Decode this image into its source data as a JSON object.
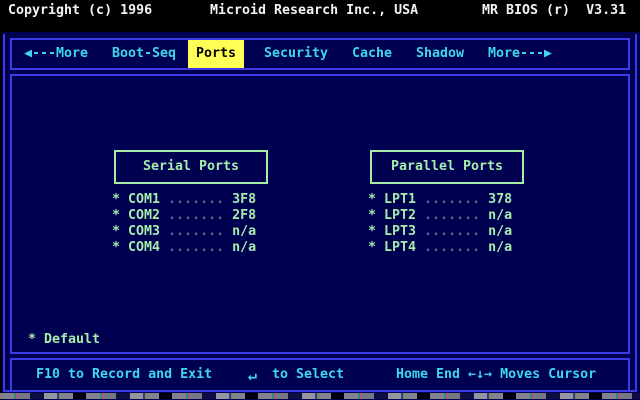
{
  "topbar": {
    "copyright": "Copyright (c) 1996",
    "company": "Microid Research Inc., USA",
    "product": "MR BIOS (r)  V3.31"
  },
  "menu": {
    "items": [
      {
        "label": "◀---More"
      },
      {
        "label": "Boot-Seq"
      },
      {
        "label": "Ports",
        "active": true
      },
      {
        "label": "Security"
      },
      {
        "label": "Cache"
      },
      {
        "label": "Shadow"
      },
      {
        "label": "More---▶"
      }
    ]
  },
  "sections": {
    "serial": {
      "title": "Serial Ports",
      "rows": [
        {
          "marker": "*",
          "label": "COM1",
          "dots": ".......",
          "value": "3F8"
        },
        {
          "marker": "*",
          "label": "COM2",
          "dots": ".......",
          "value": "2F8"
        },
        {
          "marker": "*",
          "label": "COM3",
          "dots": ".......",
          "value": "n/a"
        },
        {
          "marker": "*",
          "label": "COM4",
          "dots": ".......",
          "value": "n/a"
        }
      ]
    },
    "parallel": {
      "title": "Parallel Ports",
      "rows": [
        {
          "marker": "*",
          "label": "LPT1",
          "dots": ".......",
          "value": "378"
        },
        {
          "marker": "*",
          "label": "LPT2",
          "dots": ".......",
          "value": "n/a"
        },
        {
          "marker": "*",
          "label": "LPT3",
          "dots": ".......",
          "value": "n/a"
        },
        {
          "marker": "*",
          "label": "LPT4",
          "dots": ".......",
          "value": "n/a"
        }
      ]
    }
  },
  "footer": {
    "marker": "*",
    "default_label": "Default"
  },
  "keybar": {
    "record": "F10 to Record and Exit",
    "enter_symbol": "↵",
    "select": "to Select",
    "cursor": "Home End ←↓→ Moves Cursor"
  },
  "colors": {
    "background_navy": "#000051",
    "border_blue": "#3c3ce6",
    "text_cyan": "#3ed7ea",
    "highlight_yellow": "#ffff55",
    "text_green": "#a6ecaa",
    "dots_gray": "#6b6b8c",
    "topbar_black": "#000000",
    "topbar_white": "#f2f2f2"
  }
}
